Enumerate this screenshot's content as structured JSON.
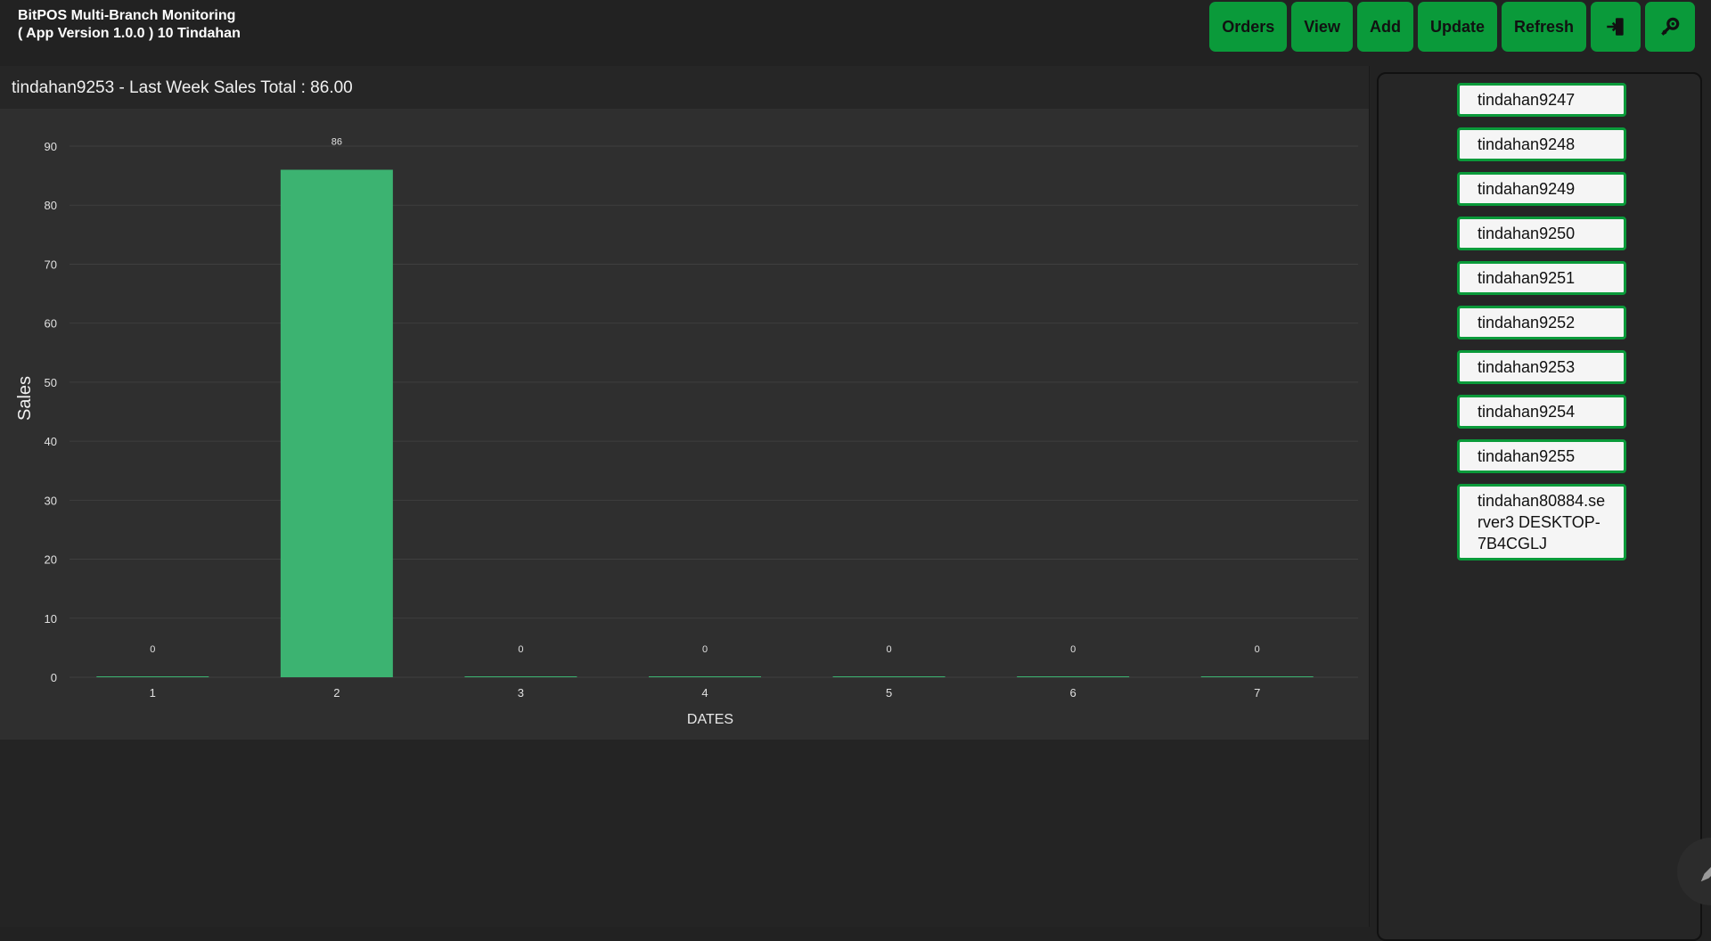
{
  "app": {
    "title_line1": "BitPOS Multi-Branch Monitoring",
    "title_line2": "( App Version 1.0.0 ) 10 Tindahan"
  },
  "toolbar": {
    "orders": "Orders",
    "view": "View",
    "add": "Add",
    "update": "Update",
    "refresh": "Refresh",
    "logout_icon": "logout-icon",
    "settings_icon": "settings-gear-icon"
  },
  "chart_header": {
    "title": "tindahan9253 - Last Week Sales Total : 86.00"
  },
  "chart_data": {
    "type": "bar",
    "categories": [
      "1",
      "2",
      "3",
      "4",
      "5",
      "6",
      "7"
    ],
    "values": [
      0,
      86,
      0,
      0,
      0,
      0,
      0
    ],
    "data_labels": [
      "0",
      "86",
      "0",
      "0",
      "0",
      "0",
      "0"
    ],
    "xlabel": "DATES",
    "ylabel": "Sales",
    "ylim": [
      0,
      90
    ],
    "yticks": [
      0,
      10,
      20,
      30,
      40,
      50,
      60,
      70,
      80,
      90
    ],
    "grid": true,
    "bar_color": "#3cb371"
  },
  "branches": [
    "tindahan9247",
    "tindahan9248",
    "tindahan9249",
    "tindahan9250",
    "tindahan9251",
    "tindahan9252",
    "tindahan9253",
    "tindahan9254",
    "tindahan9255",
    "tindahan80884.server3 DESKTOP-7B4CGLJ"
  ],
  "colors": {
    "accent": "#0a9a3a",
    "background": "#222222"
  }
}
